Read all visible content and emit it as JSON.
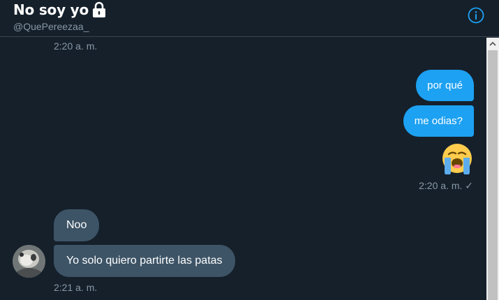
{
  "header": {
    "title": "No soy yo",
    "handle": "@QuePereezaa_",
    "lock_icon": "lock-icon",
    "info_icon": "info-icon"
  },
  "thread": {
    "top_timestamp": "2:20 a. m.",
    "outgoing": [
      {
        "text": "por qué"
      },
      {
        "text": "me odias?"
      }
    ],
    "outgoing_emoji": "loudly-crying-face-emoji",
    "outgoing_timestamp": "2:20 a. m. ✓",
    "incoming": [
      {
        "text": "Noo"
      },
      {
        "text": "Yo solo quiero partirte las patas"
      }
    ],
    "incoming_timestamp": "2:21 a. m."
  },
  "colors": {
    "background": "#15202b",
    "outgoing_bubble": "#1da1f2",
    "incoming_bubble": "#3d5466",
    "muted_text": "#8899a6",
    "accent": "#1da1f2"
  }
}
